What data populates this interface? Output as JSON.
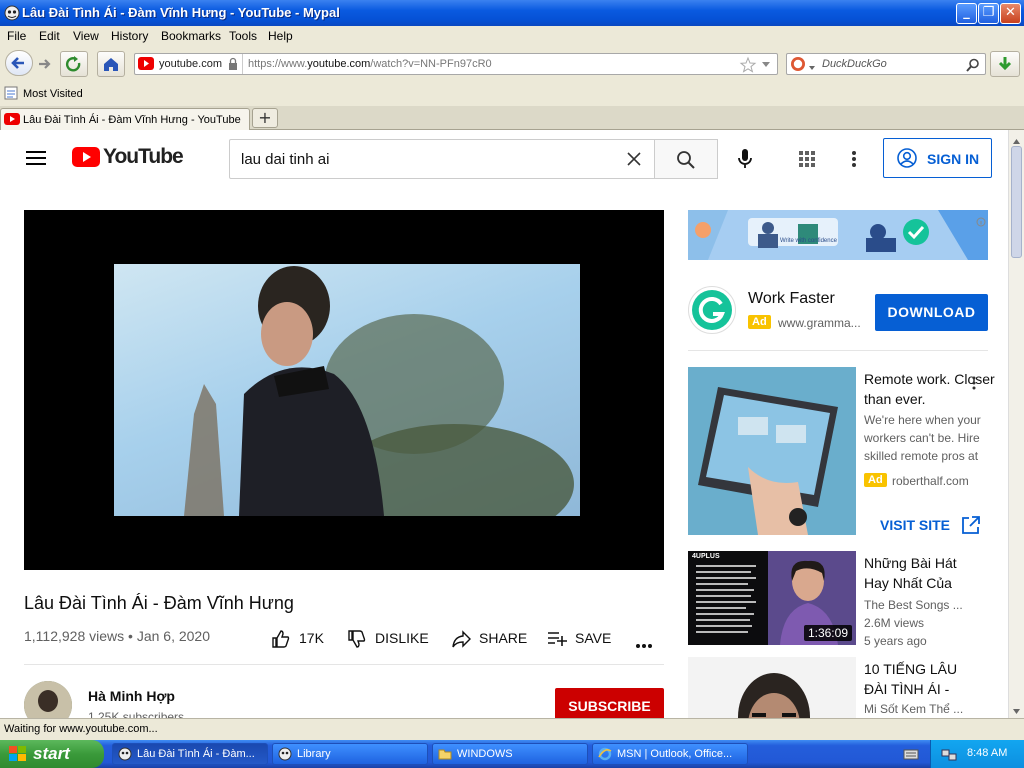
{
  "window": {
    "title": "Lâu Đài Tình Ái - Đàm Vĩnh Hưng - YouTube - Mypal"
  },
  "menu": [
    "File",
    "Edit",
    "View",
    "History",
    "Bookmarks",
    "Tools",
    "Help"
  ],
  "nav": {
    "site_label": "youtube.com",
    "url_prefix": "https://www.",
    "url_domain": "youtube.com",
    "url_path": "/watch?v=NN-PFn97cR0",
    "search_placeholder": "DuckDuckGo"
  },
  "bookmarks": {
    "most_visited": "Most Visited"
  },
  "tabs": [
    {
      "label": "Lâu Đài Tình Ái - Đàm Vĩnh Hưng - YouTube"
    }
  ],
  "youtube": {
    "logo_text": "YouTube",
    "search_query": "lau dai tinh ai",
    "sign_in": "SIGN IN",
    "video": {
      "title": "Lâu Đài Tình Ái - Đàm Vĩnh Hưng",
      "views": "1,112,928 views",
      "date": "Jan 6, 2020",
      "likes": "17K",
      "dislike_label": "DISLIKE",
      "share_label": "SHARE",
      "save_label": "SAVE"
    },
    "channel": {
      "name": "Hà Minh Hợp",
      "subscribers": "1.25K subscribers",
      "subscribe_label": "SUBSCRIBE"
    },
    "banner_ad_text": "Write with confidence",
    "ad1": {
      "title": "Work Faster",
      "ad_tag": "Ad",
      "domain": "www.gramma...",
      "cta": "DOWNLOAD"
    },
    "ad2": {
      "title_line1": "Remote work. Closer",
      "title_line2": "than ever.",
      "desc_line1": "We're here when your",
      "desc_line2": "workers can't be. Hire",
      "desc_line3": "skilled remote pros at",
      "ad_tag": "Ad",
      "domain": "roberthalf.com",
      "cta": "VISIT SITE"
    },
    "related": [
      {
        "title_line1": "Những Bài Hát",
        "title_line2": "Hay Nhất Của",
        "channel": "The Best Songs ...",
        "views": "2.6M views",
        "age": "5 years ago",
        "duration": "1:36:09",
        "thumb_label": "4UPLUS"
      },
      {
        "title_line1": "10 TIẾNG LÂU",
        "title_line2": "ĐÀI TÌNH ÁI -",
        "channel": "Mi Sốt Kem Thể ..."
      }
    ]
  },
  "status": {
    "text": "Waiting for www.youtube.com..."
  },
  "taskbar": {
    "start": "start",
    "tasks": [
      "Lâu Đài Tình Ái - Đàm...",
      "Library",
      "WINDOWS",
      "MSN | Outlook, Office..."
    ],
    "time": "8:48 AM"
  }
}
